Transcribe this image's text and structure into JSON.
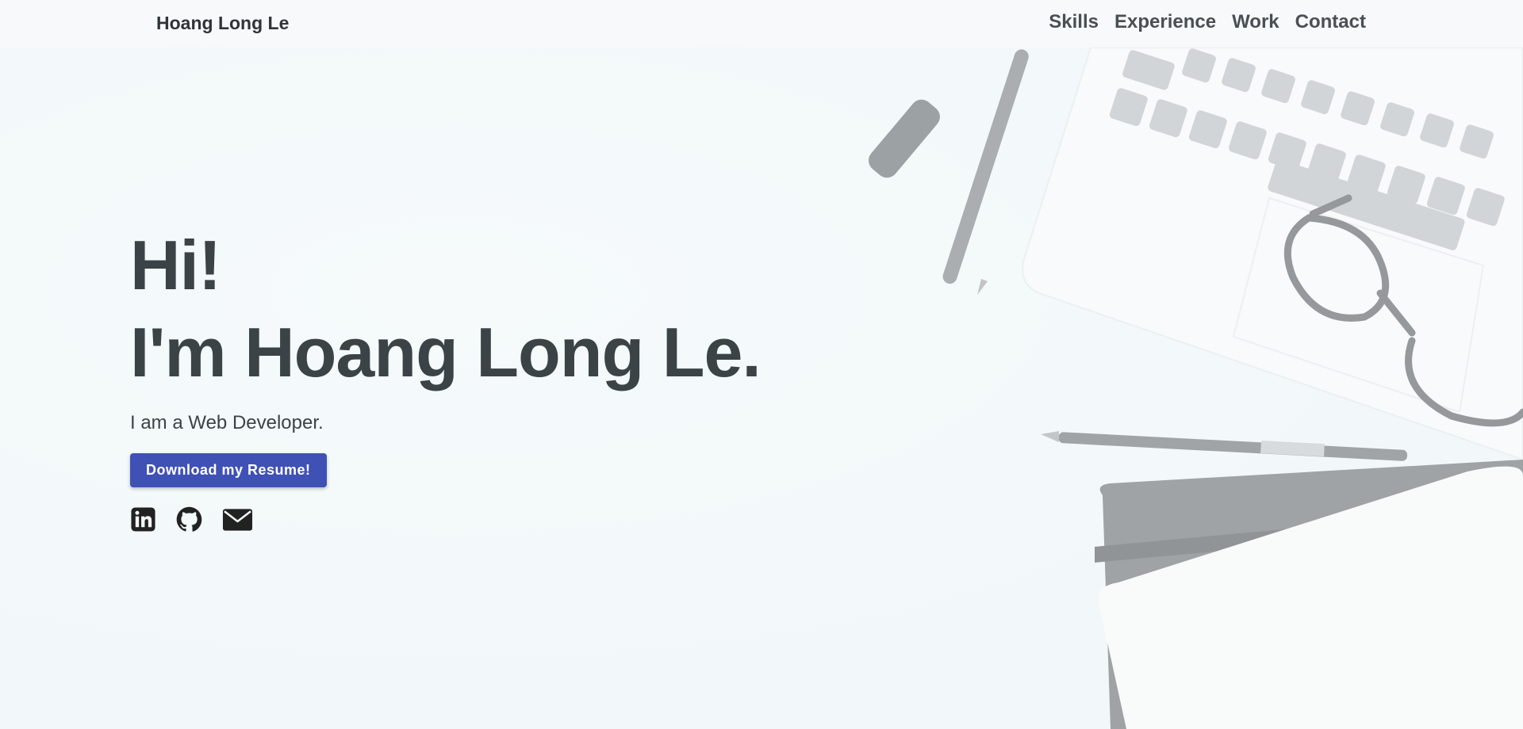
{
  "navbar": {
    "brand": "Hoang Long Le",
    "links": [
      {
        "label": "Skills"
      },
      {
        "label": "Experience"
      },
      {
        "label": "Work"
      },
      {
        "label": "Contact"
      }
    ]
  },
  "hero": {
    "greeting": "Hi!",
    "name_line": "I'm Hoang Long Le.",
    "tagline": "I am a Web Developer.",
    "resume_button": "Download my Resume!"
  },
  "social": [
    {
      "icon": "linkedin-icon"
    },
    {
      "icon": "github-icon"
    },
    {
      "icon": "email-icon"
    }
  ],
  "colors": {
    "accent": "#3f51b5",
    "text": "#3c4347",
    "background": "#f3f9fa"
  }
}
